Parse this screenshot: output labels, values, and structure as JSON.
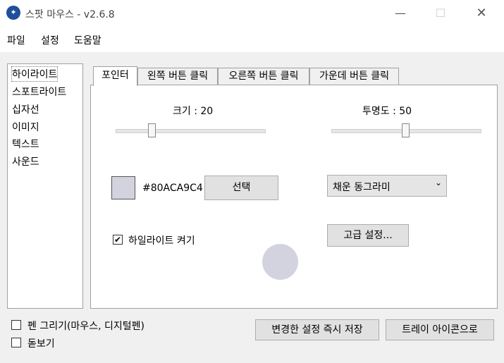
{
  "window": {
    "title": "스팟 마우스 - v2.6.8",
    "minimize_glyph": "—",
    "maximize_glyph": "☐",
    "close_glyph": "✕",
    "app_icon_glyph": "✦"
  },
  "menu": {
    "items": [
      "파일",
      "설정",
      "도움말"
    ]
  },
  "sidebar": {
    "items": [
      "하이라이트",
      "스포트라이트",
      "십자선",
      "이미지",
      "텍스트",
      "사운드"
    ],
    "selected": "하이라이트"
  },
  "tabs": {
    "items": [
      "포인터",
      "왼쪽 버튼 클릭",
      "오른쪽 버튼 클릭",
      "가운데 버튼 클릭"
    ],
    "active": "포인터"
  },
  "pointer": {
    "size_label": "크기 :  20",
    "size_value": 20,
    "size_max": 100,
    "opacity_label": "투명도 : 50",
    "opacity_value": 50,
    "opacity_max": 100,
    "color_hex": "#80ACA9C4",
    "swatch_color": "#d3d3e0",
    "select_button": "선택",
    "shape_selected": "채운 동그라미",
    "shape_chevron": "⌄",
    "highlight_checkbox_label": "하일라이트 켜기",
    "highlight_checked": true,
    "check_glyph": "✔",
    "advanced_button": "고급 설정...",
    "preview_color": "#d3d3e0"
  },
  "footer": {
    "pen_draw_label": "펜 그리기(마우스, 디지털펜)",
    "pen_draw_checked": false,
    "magnifier_label": "돋보기",
    "magnifier_checked": false,
    "save_button": "변경한 설정 즉시 저장",
    "tray_button": "트레이 아이콘으로"
  }
}
